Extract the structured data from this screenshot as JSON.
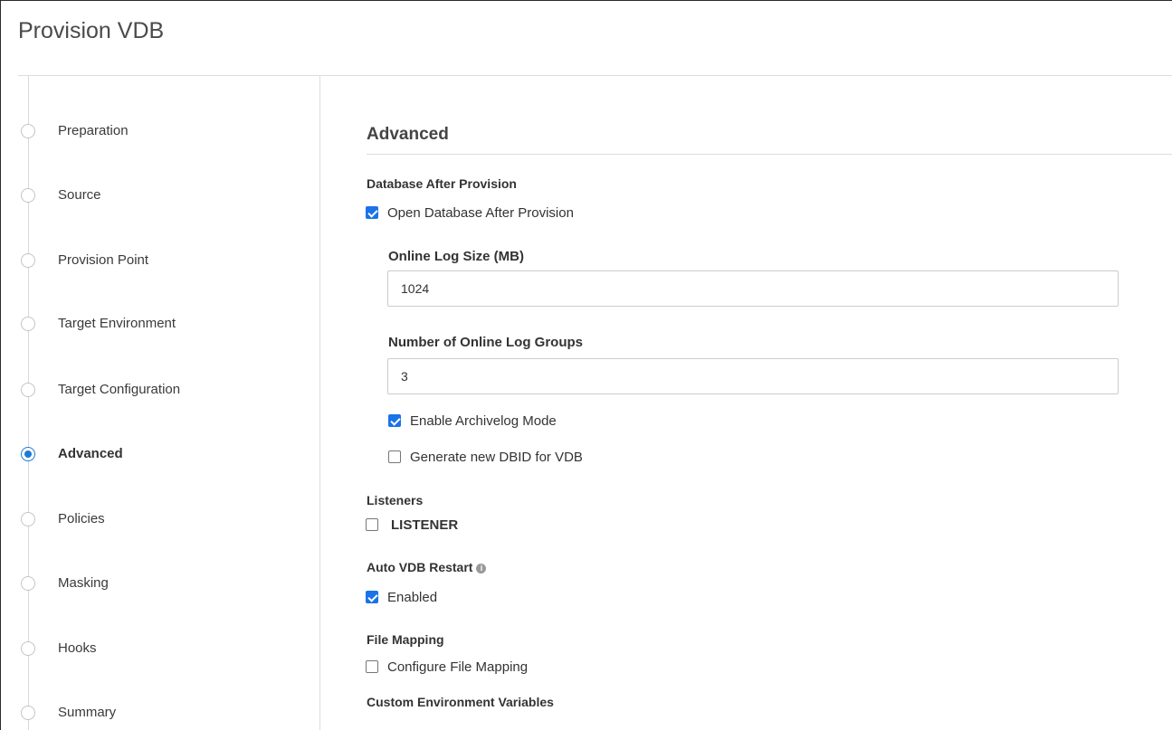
{
  "header": {
    "title": "Provision VDB"
  },
  "sidebar": {
    "steps": [
      {
        "label": "Preparation",
        "state": "pending"
      },
      {
        "label": "Source",
        "state": "pending"
      },
      {
        "label": "Provision Point",
        "state": "pending"
      },
      {
        "label": "Target Environment",
        "state": "pending"
      },
      {
        "label": "Target Configuration",
        "state": "pending"
      },
      {
        "label": "Advanced",
        "state": "active"
      },
      {
        "label": "Policies",
        "state": "pending"
      },
      {
        "label": "Masking",
        "state": "pending"
      },
      {
        "label": "Hooks",
        "state": "pending"
      },
      {
        "label": "Summary",
        "state": "pending"
      }
    ]
  },
  "main": {
    "section_title": "Advanced",
    "database_after_provision": {
      "heading": "Database After Provision",
      "open_db": {
        "label": "Open Database After Provision",
        "checked": true
      },
      "online_log_size": {
        "label": "Online Log Size (MB)",
        "value": "1024"
      },
      "online_log_groups": {
        "label": "Number of Online Log Groups",
        "value": "3"
      },
      "archivelog": {
        "label": "Enable Archivelog Mode",
        "checked": true
      },
      "new_dbid": {
        "label": "Generate new DBID for VDB",
        "checked": false
      }
    },
    "listeners": {
      "heading": "Listeners",
      "listener": {
        "label": "LISTENER",
        "checked": false
      }
    },
    "auto_restart": {
      "heading": "Auto VDB Restart",
      "info_icon": "info-icon",
      "enabled": {
        "label": "Enabled",
        "checked": true
      }
    },
    "file_mapping": {
      "heading": "File Mapping",
      "configure": {
        "label": "Configure File Mapping",
        "checked": false
      }
    },
    "custom_env": {
      "heading": "Custom Environment Variables"
    }
  },
  "colors": {
    "accent": "#1a73e8",
    "active_step": "#1f7ad6",
    "divider": "#dddddd"
  }
}
